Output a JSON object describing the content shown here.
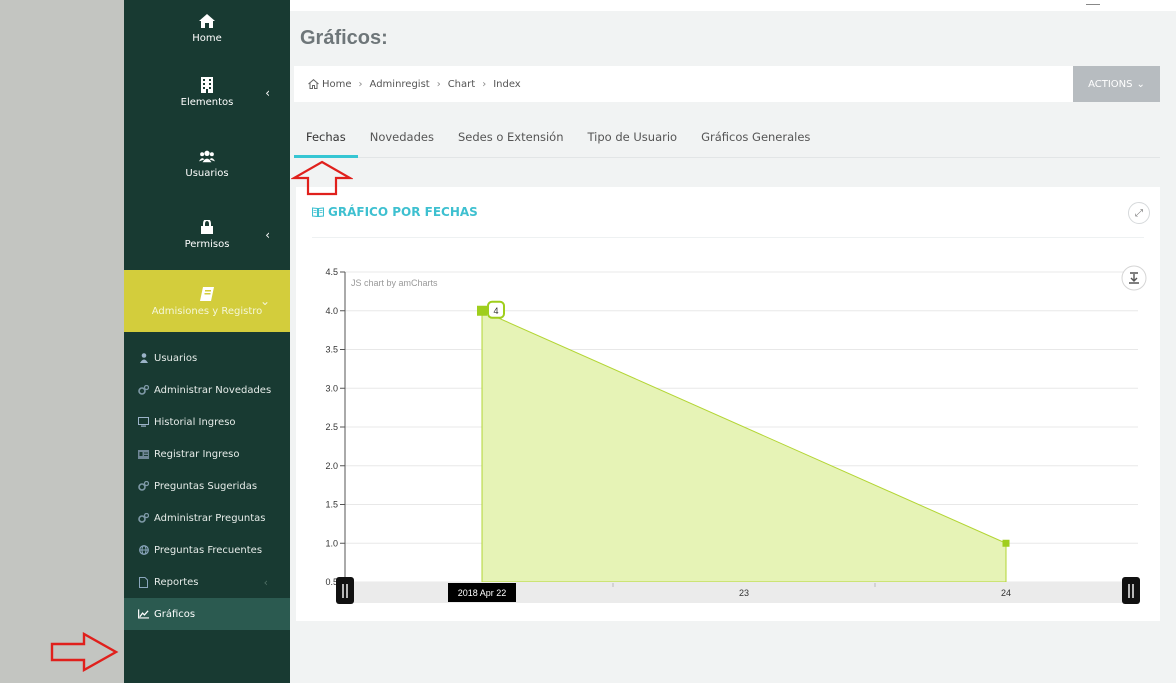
{
  "sidebar": {
    "main_items": [
      {
        "label": "Home",
        "icon": "home-icon"
      },
      {
        "label": "Elementos",
        "icon": "building-icon",
        "has_children": true
      },
      {
        "label": "Usuarios",
        "icon": "users-icon"
      },
      {
        "label": "Permisos",
        "icon": "lock-icon",
        "has_children": true
      },
      {
        "label": "Admisiones y Registro",
        "icon": "book-icon",
        "has_children": true,
        "active": true
      }
    ],
    "sub_items": [
      {
        "label": "Usuarios",
        "icon": "user-icon"
      },
      {
        "label": "Administrar Novedades",
        "icon": "cogs-icon"
      },
      {
        "label": "Historial Ingreso",
        "icon": "desktop-icon"
      },
      {
        "label": "Registrar Ingreso",
        "icon": "id-card-icon"
      },
      {
        "label": "Preguntas Sugeridas",
        "icon": "cogs-icon"
      },
      {
        "label": "Administrar Preguntas",
        "icon": "cogs-icon"
      },
      {
        "label": "Preguntas Frecuentes",
        "icon": "globe-icon"
      },
      {
        "label": "Reportes",
        "icon": "file-icon",
        "has_children": true
      },
      {
        "label": "Gráficos",
        "icon": "line-chart-icon",
        "active": true
      }
    ]
  },
  "header": {
    "title": "Gráficos:",
    "breadcrumb": [
      "Home",
      "Adminregist",
      "Chart",
      "Index"
    ],
    "actions_label": "ACTIONS"
  },
  "tabs": [
    {
      "label": "Fechas",
      "active": true
    },
    {
      "label": "Novedades"
    },
    {
      "label": "Sedes o Extensión"
    },
    {
      "label": "Tipo de Usuario"
    },
    {
      "label": "Gráficos Generales"
    }
  ],
  "card": {
    "title": "GRÁFICO POR FECHAS"
  },
  "chart_data": {
    "type": "area",
    "x": [
      "2018 Apr 22",
      "2018 Apr 24"
    ],
    "values": [
      4,
      1
    ],
    "x_tick_labels": [
      "2018 Apr 22",
      "23",
      "24"
    ],
    "y_ticks": [
      "0.5",
      "1.0",
      "1.5",
      "2.0",
      "2.5",
      "3.0",
      "3.5",
      "4.0",
      "4.5"
    ],
    "ylim": [
      0.5,
      4.5
    ],
    "bullet_label": "4",
    "credit": "JS chart by amCharts",
    "fill_color": "#e6f3b6",
    "line_color": "#b3d534",
    "grid": true
  },
  "colors": {
    "sidebar_bg": "#183a32",
    "active_menu": "#d3cd3c",
    "accent": "#36c6d3",
    "annotation_red": "#e0201c"
  }
}
